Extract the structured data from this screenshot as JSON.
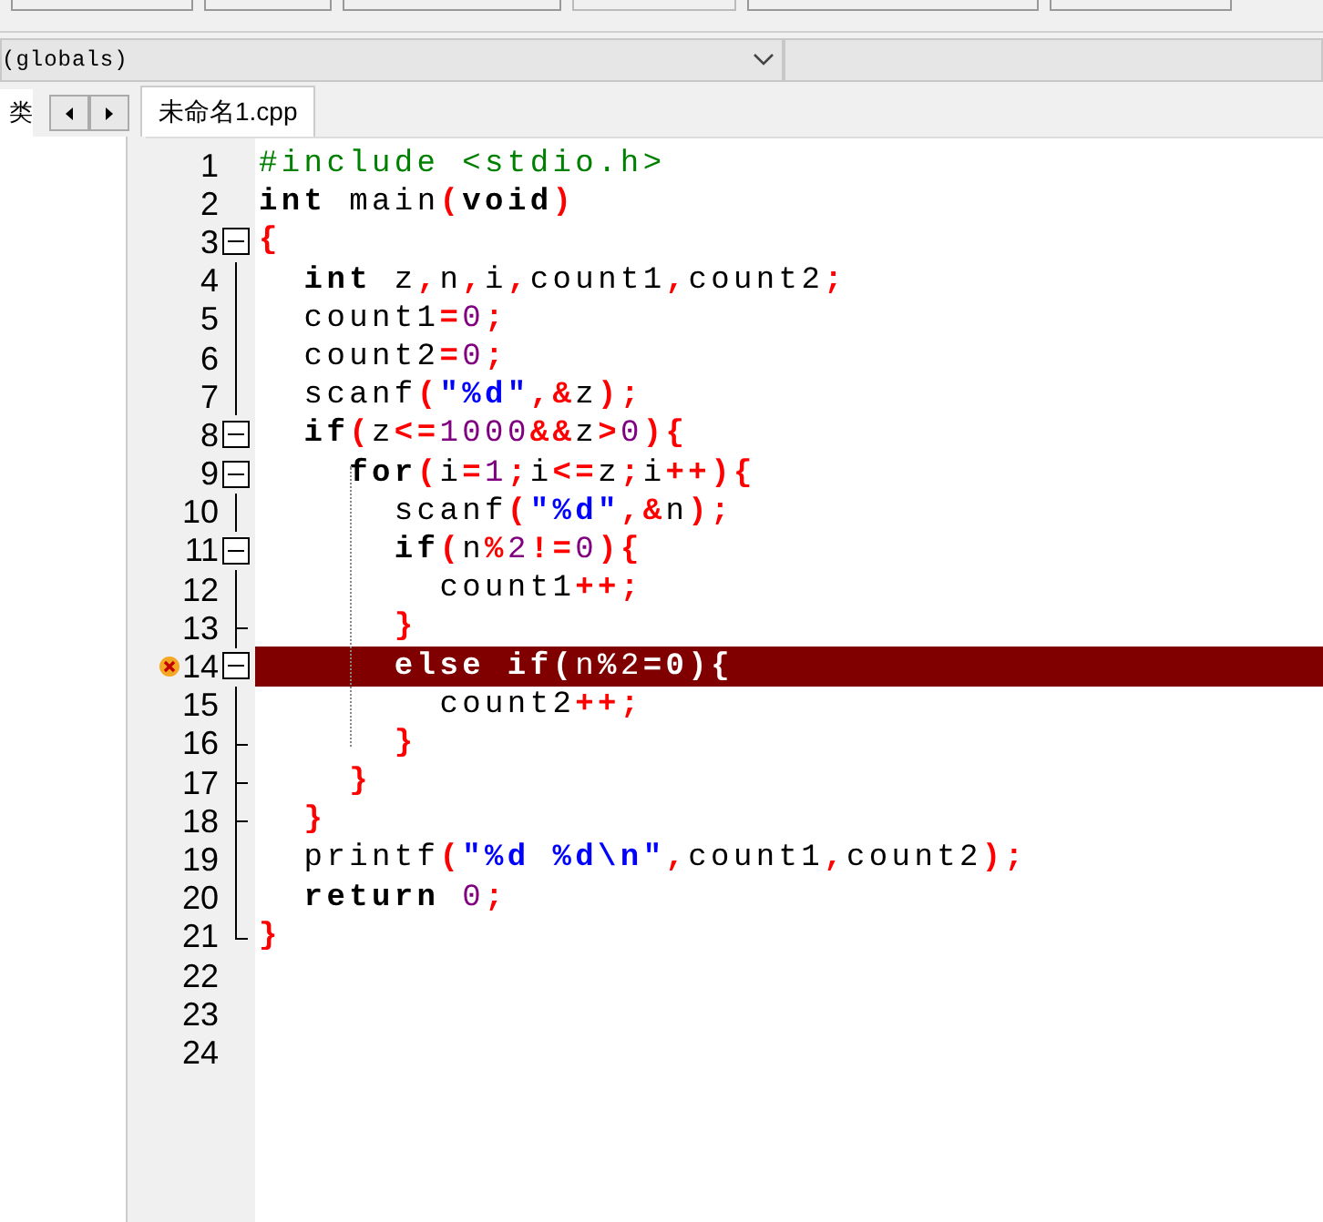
{
  "scope_combo": {
    "value": "(globals)"
  },
  "side_tab": {
    "label": "类"
  },
  "editor_tabs": [
    {
      "label": "未命名1.cpp",
      "selected": true
    }
  ],
  "lines": [
    {
      "number": "1",
      "error": false,
      "tokens": [
        {
          "kind": "preprocessor",
          "text": "#include <stdio.h>"
        }
      ]
    },
    {
      "number": "2",
      "error": false,
      "tokens": [
        {
          "kind": "keyword",
          "text": "int"
        },
        {
          "kind": "identifier",
          "text": " main"
        },
        {
          "kind": "symbol",
          "text": "("
        },
        {
          "kind": "keyword",
          "text": "void"
        },
        {
          "kind": "symbol",
          "text": ")"
        }
      ]
    },
    {
      "number": "3",
      "fold": {
        "kind": "open"
      },
      "error": false,
      "tokens": [
        {
          "kind": "symbol",
          "text": "{"
        }
      ]
    },
    {
      "number": "4",
      "fold": {
        "kind": "line"
      },
      "error": false,
      "tokens": [
        {
          "kind": "keyword",
          "text": "  int"
        },
        {
          "kind": "identifier",
          "text": " z"
        },
        {
          "kind": "symbol",
          "text": ","
        },
        {
          "kind": "identifier",
          "text": "n"
        },
        {
          "kind": "symbol",
          "text": ","
        },
        {
          "kind": "identifier",
          "text": "i"
        },
        {
          "kind": "symbol",
          "text": ","
        },
        {
          "kind": "identifier",
          "text": "count1"
        },
        {
          "kind": "symbol",
          "text": ","
        },
        {
          "kind": "identifier",
          "text": "count2"
        },
        {
          "kind": "symbol",
          "text": ";"
        }
      ]
    },
    {
      "number": "5",
      "fold": {
        "kind": "line"
      },
      "error": false,
      "tokens": [
        {
          "kind": "identifier",
          "text": "  count1"
        },
        {
          "kind": "symbol",
          "text": "="
        },
        {
          "kind": "number",
          "text": "0"
        },
        {
          "kind": "symbol",
          "text": ";"
        }
      ]
    },
    {
      "number": "6",
      "fold": {
        "kind": "line"
      },
      "error": false,
      "tokens": [
        {
          "kind": "identifier",
          "text": "  count2"
        },
        {
          "kind": "symbol",
          "text": "="
        },
        {
          "kind": "number",
          "text": "0"
        },
        {
          "kind": "symbol",
          "text": ";"
        }
      ]
    },
    {
      "number": "7",
      "fold": {
        "kind": "line"
      },
      "error": false,
      "tokens": [
        {
          "kind": "identifier",
          "text": "  scanf"
        },
        {
          "kind": "symbol",
          "text": "("
        },
        {
          "kind": "string",
          "text": "\"%d\""
        },
        {
          "kind": "symbol",
          "text": ",&"
        },
        {
          "kind": "identifier",
          "text": "z"
        },
        {
          "kind": "symbol",
          "text": ");"
        }
      ]
    },
    {
      "number": "8",
      "fold": {
        "kind": "open"
      },
      "error": false,
      "tokens": [
        {
          "kind": "keyword",
          "text": "  if"
        },
        {
          "kind": "symbol",
          "text": "("
        },
        {
          "kind": "identifier",
          "text": "z"
        },
        {
          "kind": "symbol",
          "text": "<="
        },
        {
          "kind": "number",
          "text": "1000"
        },
        {
          "kind": "symbol",
          "text": "&&"
        },
        {
          "kind": "identifier",
          "text": "z"
        },
        {
          "kind": "symbol",
          "text": ">"
        },
        {
          "kind": "number",
          "text": "0"
        },
        {
          "kind": "symbol",
          "text": "){"
        }
      ]
    },
    {
      "number": "9",
      "fold": {
        "kind": "open"
      },
      "error": false,
      "tokens": [
        {
          "kind": "keyword",
          "text": "    for"
        },
        {
          "kind": "symbol",
          "text": "("
        },
        {
          "kind": "identifier",
          "text": "i"
        },
        {
          "kind": "symbol",
          "text": "="
        },
        {
          "kind": "number",
          "text": "1"
        },
        {
          "kind": "symbol",
          "text": ";"
        },
        {
          "kind": "identifier",
          "text": "i"
        },
        {
          "kind": "symbol",
          "text": "<="
        },
        {
          "kind": "identifier",
          "text": "z"
        },
        {
          "kind": "symbol",
          "text": ";"
        },
        {
          "kind": "identifier",
          "text": "i"
        },
        {
          "kind": "symbol",
          "text": "++){"
        }
      ]
    },
    {
      "number": "10",
      "fold": {
        "kind": "line"
      },
      "error": false,
      "tokens": [
        {
          "kind": "identifier",
          "text": "      scanf"
        },
        {
          "kind": "symbol",
          "text": "("
        },
        {
          "kind": "string",
          "text": "\"%d\""
        },
        {
          "kind": "symbol",
          "text": ",&"
        },
        {
          "kind": "identifier",
          "text": "n"
        },
        {
          "kind": "symbol",
          "text": ");"
        }
      ]
    },
    {
      "number": "11",
      "fold": {
        "kind": "open"
      },
      "error": false,
      "tokens": [
        {
          "kind": "keyword",
          "text": "      if"
        },
        {
          "kind": "symbol",
          "text": "("
        },
        {
          "kind": "identifier",
          "text": "n"
        },
        {
          "kind": "symbol",
          "text": "%"
        },
        {
          "kind": "number",
          "text": "2"
        },
        {
          "kind": "symbol",
          "text": "!="
        },
        {
          "kind": "number",
          "text": "0"
        },
        {
          "kind": "symbol",
          "text": "){"
        }
      ]
    },
    {
      "number": "12",
      "fold": {
        "kind": "line"
      },
      "error": false,
      "tokens": [
        {
          "kind": "identifier",
          "text": "        count1"
        },
        {
          "kind": "symbol",
          "text": "++;"
        }
      ]
    },
    {
      "number": "13",
      "fold": {
        "kind": "branch"
      },
      "error": false,
      "tokens": [
        {
          "kind": "symbol",
          "text": "      }"
        }
      ]
    },
    {
      "number": "14",
      "fold": {
        "kind": "open"
      },
      "error": true,
      "tokens": [
        {
          "kind": "keyword",
          "text": "      else if"
        },
        {
          "kind": "symbol",
          "text": "("
        },
        {
          "kind": "identifier",
          "text": "n"
        },
        {
          "kind": "symbol",
          "text": "%"
        },
        {
          "kind": "number",
          "text": "2"
        },
        {
          "kind": "symbol",
          "text": "=0){"
        }
      ]
    },
    {
      "number": "15",
      "fold": {
        "kind": "line"
      },
      "error": false,
      "tokens": [
        {
          "kind": "identifier",
          "text": "        count2"
        },
        {
          "kind": "symbol",
          "text": "++;"
        }
      ]
    },
    {
      "number": "16",
      "fold": {
        "kind": "branch"
      },
      "error": false,
      "tokens": [
        {
          "kind": "symbol",
          "text": "      }"
        }
      ]
    },
    {
      "number": "17",
      "fold": {
        "kind": "branch"
      },
      "error": false,
      "tokens": [
        {
          "kind": "symbol",
          "text": "    }"
        }
      ]
    },
    {
      "number": "18",
      "fold": {
        "kind": "branch"
      },
      "error": false,
      "tokens": [
        {
          "kind": "symbol",
          "text": "  }"
        }
      ]
    },
    {
      "number": "19",
      "fold": {
        "kind": "line"
      },
      "error": false,
      "tokens": [
        {
          "kind": "identifier",
          "text": "  printf"
        },
        {
          "kind": "symbol",
          "text": "("
        },
        {
          "kind": "string",
          "text": "\"%d %d\\n\""
        },
        {
          "kind": "symbol",
          "text": ","
        },
        {
          "kind": "identifier",
          "text": "count1"
        },
        {
          "kind": "symbol",
          "text": ","
        },
        {
          "kind": "identifier",
          "text": "count2"
        },
        {
          "kind": "symbol",
          "text": ");"
        }
      ]
    },
    {
      "number": "20",
      "fold": {
        "kind": "line"
      },
      "error": false,
      "tokens": [
        {
          "kind": "keyword",
          "text": "  return"
        },
        {
          "kind": "number",
          "text": " 0"
        },
        {
          "kind": "symbol",
          "text": ";"
        }
      ]
    },
    {
      "number": "21",
      "fold": {
        "kind": "end"
      },
      "error": false,
      "tokens": [
        {
          "kind": "symbol",
          "text": "}"
        }
      ]
    },
    {
      "number": "22",
      "error": false
    },
    {
      "number": "23",
      "error": false
    },
    {
      "number": "24",
      "error": false
    }
  ]
}
